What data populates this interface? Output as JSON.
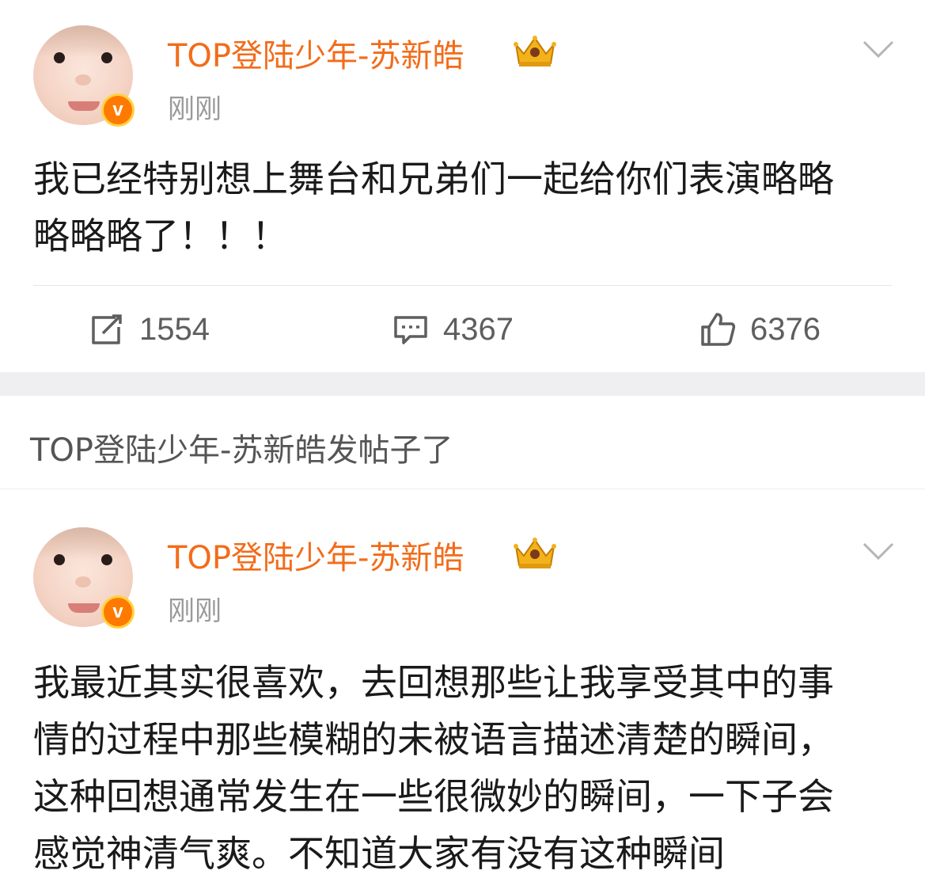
{
  "posts": [
    {
      "username": "TOP登陆少年-苏新皓",
      "time": "刚刚",
      "content": "我已经特别想上舞台和兄弟们一起给你们表演略略\n略略略了！！！",
      "repost_count": "1554",
      "comment_count": "4367",
      "like_count": "6376",
      "badge_letter": "v"
    },
    {
      "username": "TOP登陆少年-苏新皓",
      "time": "刚刚",
      "content": "我最近其实很喜欢，去回想那些让我享受其中的事\n情的过程中那些模糊的未被语言描述清楚的瞬间，\n这种回想通常发生在一些很微妙的瞬间，一下子会\n感觉神清气爽。不知道大家有没有这种瞬间",
      "badge_letter": "v"
    }
  ],
  "notice": {
    "text": "TOP登陆少年-苏新皓发帖子了"
  },
  "colors": {
    "username": "#f26c1a",
    "badge": "#ff7a00",
    "time": "#9a9a9a",
    "separator_band": "#efeff2"
  },
  "icons": {
    "repost": "repost-icon",
    "comment": "comment-icon",
    "like": "like-icon",
    "more": "chevron-down-icon",
    "vip": "crown-icon"
  }
}
